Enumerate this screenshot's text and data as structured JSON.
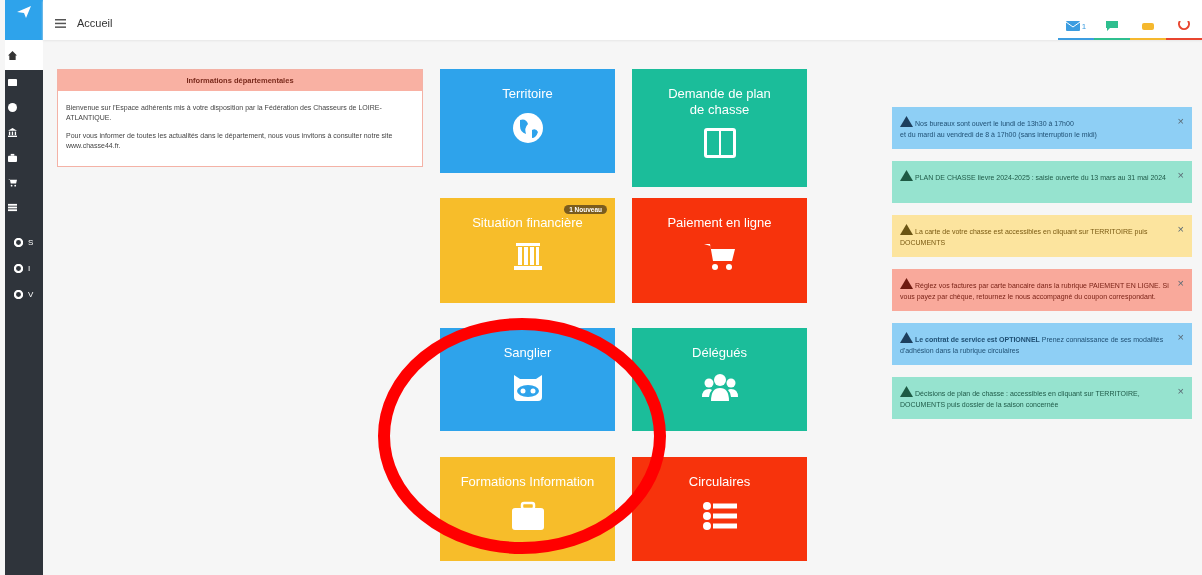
{
  "header": {
    "title": "Accueil"
  },
  "top_icons": [
    {
      "kind": "mail",
      "badge": "1",
      "color": "#3c9de0"
    },
    {
      "kind": "chat",
      "color": "#2fbf8f"
    },
    {
      "kind": "note",
      "color": "#f5b82e"
    },
    {
      "kind": "power",
      "color": "#e8452f"
    }
  ],
  "sidebar": {
    "items": [
      {
        "kind": "home",
        "selected": true
      },
      {
        "kind": "columns",
        "selected": false
      },
      {
        "kind": "globe",
        "selected": false
      },
      {
        "kind": "bank",
        "selected": false
      },
      {
        "kind": "briefcase",
        "selected": false
      },
      {
        "kind": "cart",
        "selected": false
      },
      {
        "kind": "list",
        "selected": false
      }
    ],
    "settings": [
      {
        "label": "S"
      },
      {
        "label": "I"
      },
      {
        "label": "V"
      }
    ]
  },
  "info_panel": {
    "title": "Informations départementales",
    "paragraphs": [
      "Bienvenue sur l'Espace adhérents mis à votre disposition par la Fédération des Chasseurs de LOIRE-ATLANTIQUE.",
      "Pour vous informer de toutes les actualités dans le département, nous vous invitons à consulter notre site www.chasse44.fr."
    ]
  },
  "tiles": [
    {
      "title": "Territoire",
      "kind": "globe",
      "color": "#2ea3eb"
    },
    {
      "title": "Demande de plan de chasse",
      "kind": "columns",
      "color": "#1bbd9a"
    },
    {
      "title": "Situation financière",
      "kind": "bank",
      "color": "#f7bd2a",
      "badge": "1 Nouveau"
    },
    {
      "title": "Paiement en ligne",
      "kind": "cart",
      "color": "#f7330c"
    },
    {
      "title": "Sanglier",
      "kind": "robot",
      "color": "#2ea3eb"
    },
    {
      "title": "Délégués",
      "kind": "users",
      "color": "#1bbd9a"
    },
    {
      "title": "Formations Information",
      "kind": "briefcase",
      "color": "#f7bd2a"
    },
    {
      "title": "Circulaires",
      "kind": "list",
      "color": "#f7330c"
    }
  ],
  "alerts": [
    {
      "kind": "info",
      "text": "Nos bureaux sont ouvert le lundi de 13h30 à 17h00\net du mardi au vendredi de 8 à 17h00 (sans interruption le midi)",
      "close": "×"
    },
    {
      "kind": "success",
      "text": "PLAN DE CHASSE lievre 2024-2025 : saisie ouverte du 13 mars au 31 mai 2024",
      "close": "×"
    },
    {
      "kind": "warning",
      "text": "La carte de votre chasse est accessibles en cliquant sur TERRITOIRE puis DOCUMENTS",
      "close": "×"
    },
    {
      "kind": "danger",
      "text": "Réglez vos factures par carte bancaire dans la rubrique PAIEMENT EN LIGNE. Si vous payez par chèque, retournez le nous accompagné du coupon correspondant.",
      "close": "×"
    },
    {
      "kind": "info",
      "text": "**Le contrat de service est OPTIONNEL** Prenez connaissance de ses modalités d'adhésion dans la rubrique circulaires",
      "close": "×"
    },
    {
      "kind": "success",
      "text": "Décisions de plan de chasse : accessibles en cliquant sur TERRITOIRE, DOCUMENTS puis dossier de la saison concernée",
      "close": "×"
    }
  ]
}
